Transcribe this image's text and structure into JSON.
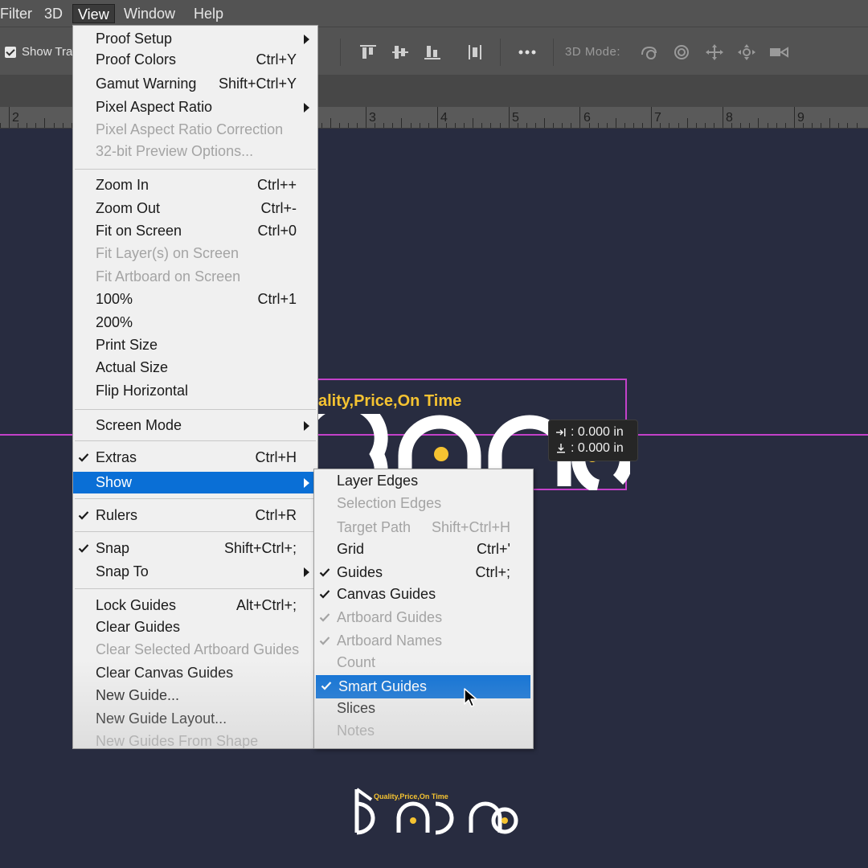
{
  "menubar": {
    "items": [
      "Filter",
      "3D",
      "View",
      "Window",
      "Help"
    ]
  },
  "optionsbar": {
    "show_transform_label": "Show Tra",
    "mode_3d_label": "3D Mode:"
  },
  "ruler": {
    "numbers": [
      "2",
      "3",
      "4",
      "5",
      "6",
      "7",
      "8",
      "9"
    ]
  },
  "canvas": {
    "tagline": "ality,Price,On Time",
    "tooltip": {
      "x_value": ": 0.000 in",
      "y_value": ": 0.000 in"
    }
  },
  "view_menu": {
    "items": [
      {
        "label": "Proof Setup",
        "shortcut": "",
        "submenu": true,
        "disabled": false,
        "checked": false
      },
      {
        "label": "Proof Colors",
        "shortcut": "Ctrl+Y",
        "submenu": false,
        "disabled": false,
        "checked": false
      },
      {
        "label": "Gamut Warning",
        "shortcut": "Shift+Ctrl+Y",
        "submenu": false,
        "disabled": false,
        "checked": false
      },
      {
        "label": "Pixel Aspect Ratio",
        "shortcut": "",
        "submenu": true,
        "disabled": false,
        "checked": false
      },
      {
        "label": "Pixel Aspect Ratio Correction",
        "shortcut": "",
        "submenu": false,
        "disabled": true,
        "checked": false
      },
      {
        "label": "32-bit Preview Options...",
        "shortcut": "",
        "submenu": false,
        "disabled": true,
        "checked": false
      },
      {
        "label": "Zoom In",
        "shortcut": "Ctrl++",
        "submenu": false,
        "disabled": false,
        "checked": false
      },
      {
        "label": "Zoom Out",
        "shortcut": "Ctrl+-",
        "submenu": false,
        "disabled": false,
        "checked": false
      },
      {
        "label": "Fit on Screen",
        "shortcut": "Ctrl+0",
        "submenu": false,
        "disabled": false,
        "checked": false
      },
      {
        "label": "Fit Layer(s) on Screen",
        "shortcut": "",
        "submenu": false,
        "disabled": true,
        "checked": false
      },
      {
        "label": "Fit Artboard on Screen",
        "shortcut": "",
        "submenu": false,
        "disabled": true,
        "checked": false
      },
      {
        "label": "100%",
        "shortcut": "Ctrl+1",
        "submenu": false,
        "disabled": false,
        "checked": false
      },
      {
        "label": "200%",
        "shortcut": "",
        "submenu": false,
        "disabled": false,
        "checked": false
      },
      {
        "label": "Print Size",
        "shortcut": "",
        "submenu": false,
        "disabled": false,
        "checked": false
      },
      {
        "label": "Actual Size",
        "shortcut": "",
        "submenu": false,
        "disabled": false,
        "checked": false
      },
      {
        "label": "Flip Horizontal",
        "shortcut": "",
        "submenu": false,
        "disabled": false,
        "checked": false
      },
      {
        "label": "Screen Mode",
        "shortcut": "",
        "submenu": true,
        "disabled": false,
        "checked": false
      },
      {
        "label": "Extras",
        "shortcut": "Ctrl+H",
        "submenu": false,
        "disabled": false,
        "checked": true
      },
      {
        "label": "Show",
        "shortcut": "",
        "submenu": true,
        "disabled": false,
        "checked": false,
        "highlight": true
      },
      {
        "label": "Rulers",
        "shortcut": "Ctrl+R",
        "submenu": false,
        "disabled": false,
        "checked": true
      },
      {
        "label": "Snap",
        "shortcut": "Shift+Ctrl+;",
        "submenu": false,
        "disabled": false,
        "checked": true
      },
      {
        "label": "Snap To",
        "shortcut": "",
        "submenu": true,
        "disabled": false,
        "checked": false
      },
      {
        "label": "Lock Guides",
        "shortcut": "Alt+Ctrl+;",
        "submenu": false,
        "disabled": false,
        "checked": false
      },
      {
        "label": "Clear Guides",
        "shortcut": "",
        "submenu": false,
        "disabled": false,
        "checked": false
      },
      {
        "label": "Clear Selected Artboard Guides",
        "shortcut": "",
        "submenu": false,
        "disabled": true,
        "checked": false
      },
      {
        "label": "Clear Canvas Guides",
        "shortcut": "",
        "submenu": false,
        "disabled": false,
        "checked": false
      },
      {
        "label": "New Guide...",
        "shortcut": "",
        "submenu": false,
        "disabled": false,
        "checked": false
      },
      {
        "label": "New Guide Layout...",
        "shortcut": "",
        "submenu": false,
        "disabled": false,
        "checked": false
      },
      {
        "label": "New Guides From Shape",
        "shortcut": "",
        "submenu": false,
        "disabled": true,
        "checked": false
      }
    ]
  },
  "show_submenu": {
    "items": [
      {
        "label": "Layer Edges",
        "shortcut": "",
        "disabled": false,
        "checked": false
      },
      {
        "label": "Selection Edges",
        "shortcut": "",
        "disabled": true,
        "checked": false
      },
      {
        "label": "Target Path",
        "shortcut": "Shift+Ctrl+H",
        "disabled": true,
        "checked": false
      },
      {
        "label": "Grid",
        "shortcut": "Ctrl+'",
        "disabled": false,
        "checked": false
      },
      {
        "label": "Guides",
        "shortcut": "Ctrl+;",
        "disabled": false,
        "checked": true
      },
      {
        "label": "Canvas Guides",
        "shortcut": "",
        "disabled": false,
        "checked": true
      },
      {
        "label": "Artboard Guides",
        "shortcut": "",
        "disabled": true,
        "checked": true
      },
      {
        "label": "Artboard Names",
        "shortcut": "",
        "disabled": true,
        "checked": true
      },
      {
        "label": "Count",
        "shortcut": "",
        "disabled": true,
        "checked": false
      },
      {
        "label": "Smart Guides",
        "shortcut": "",
        "disabled": false,
        "checked": true,
        "highlight": true
      },
      {
        "label": "Slices",
        "shortcut": "",
        "disabled": false,
        "checked": false
      },
      {
        "label": "Notes",
        "shortcut": "",
        "disabled": true,
        "checked": false
      }
    ]
  },
  "brand": {
    "tagline": "Quality,Price,On Time"
  },
  "colors": {
    "canvas_bg": "#282c40",
    "menu_bg": "#f0f0f0",
    "highlight": "#0a6fd6",
    "guide": "#c341c9",
    "brand_yellow": "#f5c331"
  }
}
